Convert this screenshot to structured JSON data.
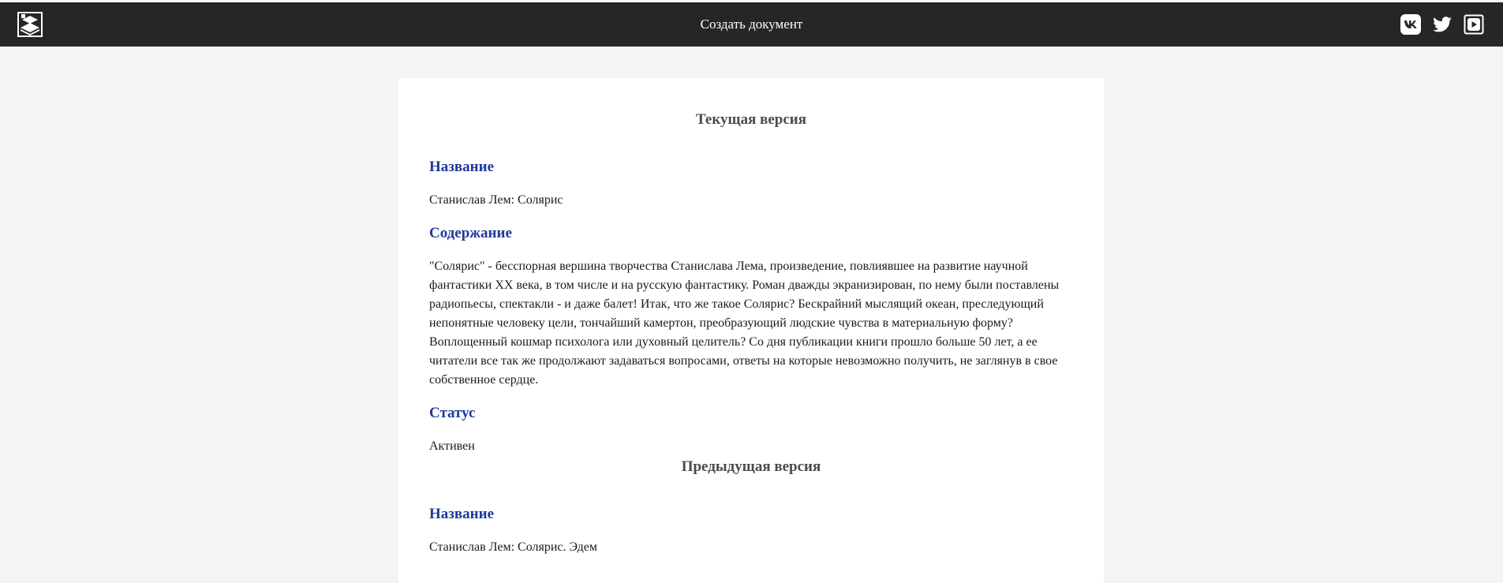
{
  "navbar": {
    "logo_icon": "book-stack-icon",
    "title": "Создать документ",
    "background": "#262626",
    "social": [
      {
        "icon": "vk-icon"
      },
      {
        "icon": "twitter-icon"
      },
      {
        "icon": "youtube-icon"
      }
    ]
  },
  "current_version": {
    "heading": "Текущая версия",
    "name_label": "Название",
    "name_value": "Станислав Лем: Солярис",
    "content_label": "Содержание",
    "content_value": "\"Солярис\" - бесспорная вершина творчества Станислава Лема, произведение, повлиявшее на развитие научной фантастики XX века, в том числе и на русскую фантастику. Роман дважды экранизирован, по нему были поставлены радиопьесы, спектакли - и даже балет! Итак, что же такое Солярис? Бескрайний мыслящий океан, преследующий непонятные человеку цели, тончайший камертон, преобразующий людские чувства в материальную форму? Воплощенный кошмар психолога или духовный целитель? Со дня публикации книги прошло больше 50 лет, а ее читатели все так же продолжают задаваться вопросами, ответы на которые невозможно получить, не заглянув в свое собственное сердце.",
    "status_label": "Статус",
    "status_value": "Активен"
  },
  "previous_version": {
    "heading": "Предыдущая версия",
    "name_label": "Название",
    "name_value": "Станислав Лем: Солярис. Эдем"
  },
  "colors": {
    "label": "#1e3a9a",
    "heading": "#4b4b4b",
    "page_bg": "#f3f4f6"
  }
}
